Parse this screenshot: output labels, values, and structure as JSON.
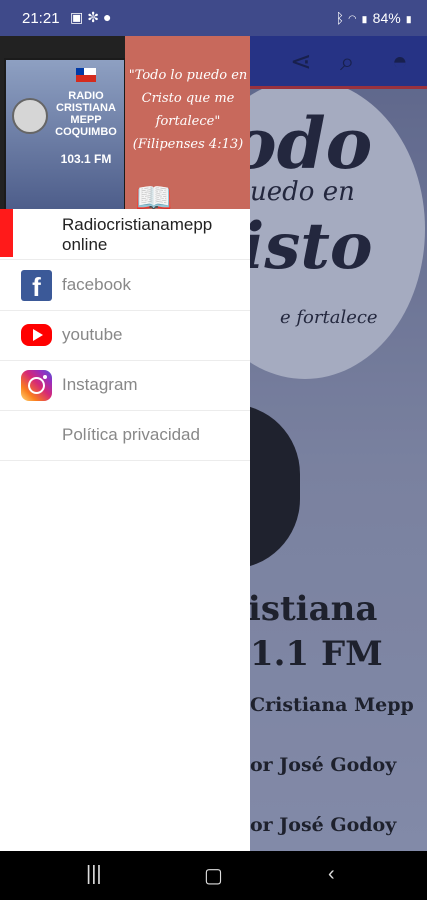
{
  "status_bar": {
    "time": "21:21",
    "left_icons": [
      "image-icon",
      "fan-icon",
      "drop-icon"
    ],
    "battery": "84%"
  },
  "drawer": {
    "header_logo": {
      "lines": [
        "RADIO",
        "CRISTIANA",
        "MEPP",
        "COQUIMBO"
      ],
      "frequency": "103.1 FM"
    },
    "header_verse": "\"Todo lo puedo en Cristo que me fortalece\" (Filipenses 4:13)",
    "items": [
      {
        "label": "Radiocristianamepp online",
        "icon": null,
        "active": true
      },
      {
        "label": "facebook",
        "icon": "facebook-icon",
        "active": false
      },
      {
        "label": "youtube",
        "icon": "youtube-icon",
        "active": false
      },
      {
        "label": "Instagram",
        "icon": "instagram-icon",
        "active": false
      },
      {
        "label": "Política privacidad",
        "icon": null,
        "active": false
      }
    ]
  },
  "background_app": {
    "disc_text": [
      "odo",
      "uedo en",
      "isto",
      "e fortalece"
    ],
    "title_line1": "ristiana",
    "title_line2": "1.1 FM",
    "line1": "Cristiana Mepp",
    "line2": "or José Godoy",
    "line3": "or José Godoy"
  },
  "colors": {
    "accent_red": "#ff1a1a",
    "toolbar": "#1f2d8a",
    "status_bar": "#3f4a8a"
  }
}
